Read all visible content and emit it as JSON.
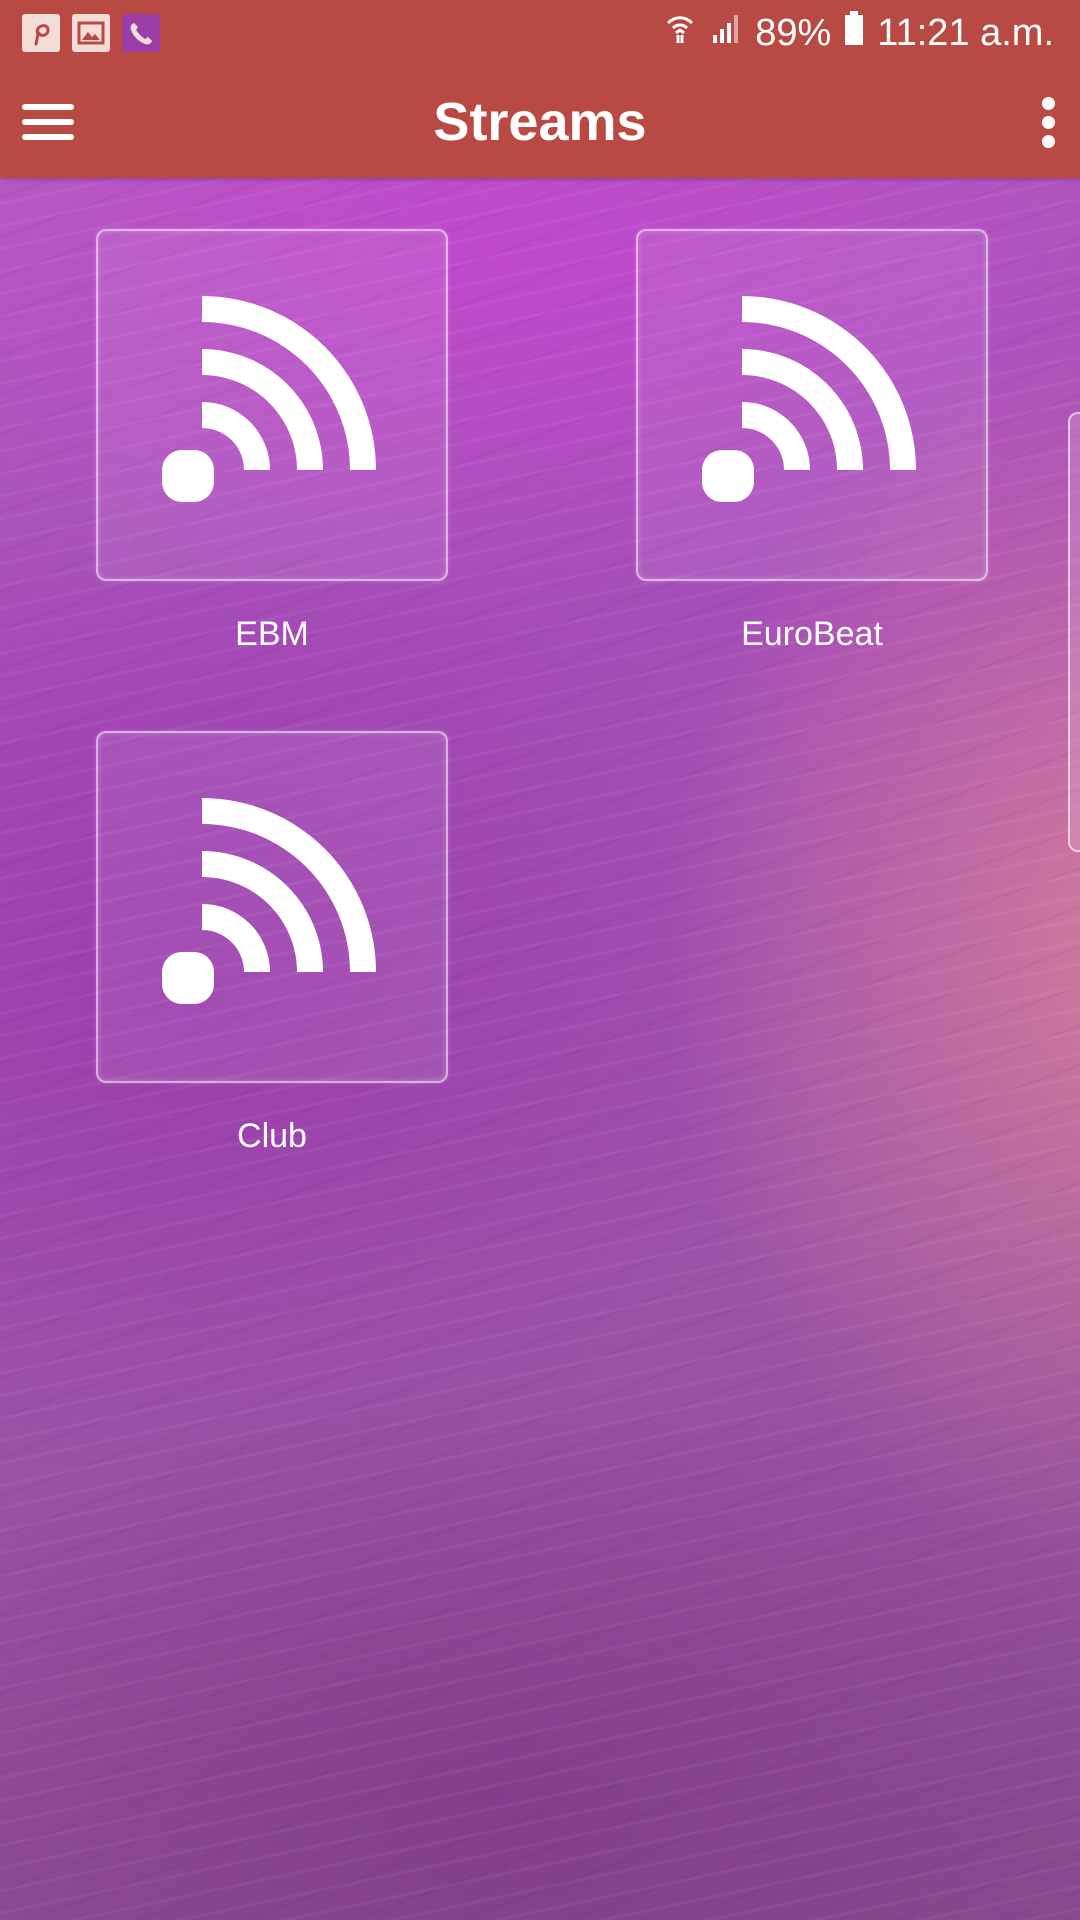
{
  "status_bar": {
    "battery": "89%",
    "time": "11:21 a.m.",
    "icons": [
      "pinterest-icon",
      "gallery-icon",
      "phone-icon",
      "wifi-calling-icon",
      "signal-icon",
      "battery-icon"
    ]
  },
  "app_bar": {
    "title": "Streams",
    "menu_icon": "hamburger-menu-icon",
    "overflow_icon": "more-vert-icon"
  },
  "streams": [
    {
      "label": "EBM",
      "icon": "rss-icon"
    },
    {
      "label": "EuroBeat",
      "icon": "rss-icon"
    },
    {
      "label": "Club",
      "icon": "rss-icon"
    }
  ],
  "colors": {
    "app_bar": "#b84a43",
    "background": "#a54db8"
  }
}
